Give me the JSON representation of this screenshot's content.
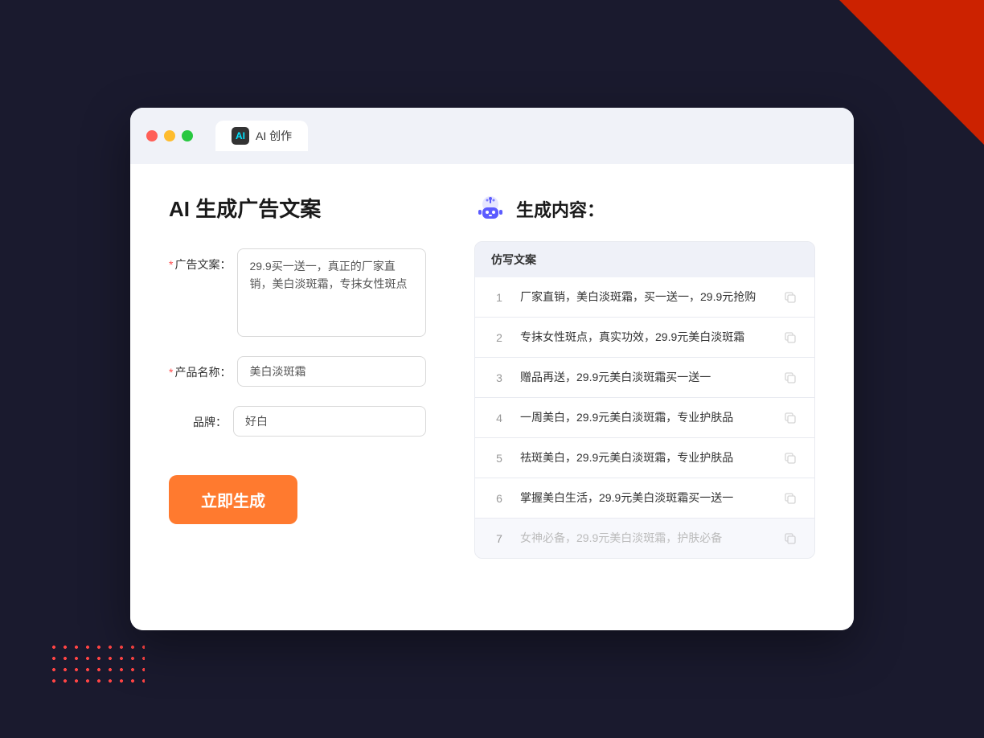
{
  "window": {
    "tab_icon_text": "AI",
    "tab_title": "AI 创作"
  },
  "left_panel": {
    "title": "AI 生成广告文案",
    "form": {
      "ad_copy_label": "广告文案：",
      "ad_copy_required": true,
      "ad_copy_value": "29.9买一送一，真正的厂家直销，美白淡斑霜，专抹女性斑点",
      "product_name_label": "产品名称：",
      "product_name_required": true,
      "product_name_value": "美白淡斑霜",
      "brand_label": "品牌：",
      "brand_required": false,
      "brand_value": "好白"
    },
    "generate_button": "立即生成"
  },
  "right_panel": {
    "title": "生成内容：",
    "table_header": "仿写文案",
    "results": [
      {
        "id": 1,
        "text": "厂家直销，美白淡斑霜，买一送一，29.9元抢购",
        "muted": false
      },
      {
        "id": 2,
        "text": "专抹女性斑点，真实功效，29.9元美白淡斑霜",
        "muted": false
      },
      {
        "id": 3,
        "text": "赠品再送，29.9元美白淡斑霜买一送一",
        "muted": false
      },
      {
        "id": 4,
        "text": "一周美白，29.9元美白淡斑霜，专业护肤品",
        "muted": false
      },
      {
        "id": 5,
        "text": "祛斑美白，29.9元美白淡斑霜，专业护肤品",
        "muted": false
      },
      {
        "id": 6,
        "text": "掌握美白生活，29.9元美白淡斑霜买一送一",
        "muted": false
      },
      {
        "id": 7,
        "text": "女神必备，29.9元美白淡斑霜，护肤必备",
        "muted": true
      }
    ]
  }
}
